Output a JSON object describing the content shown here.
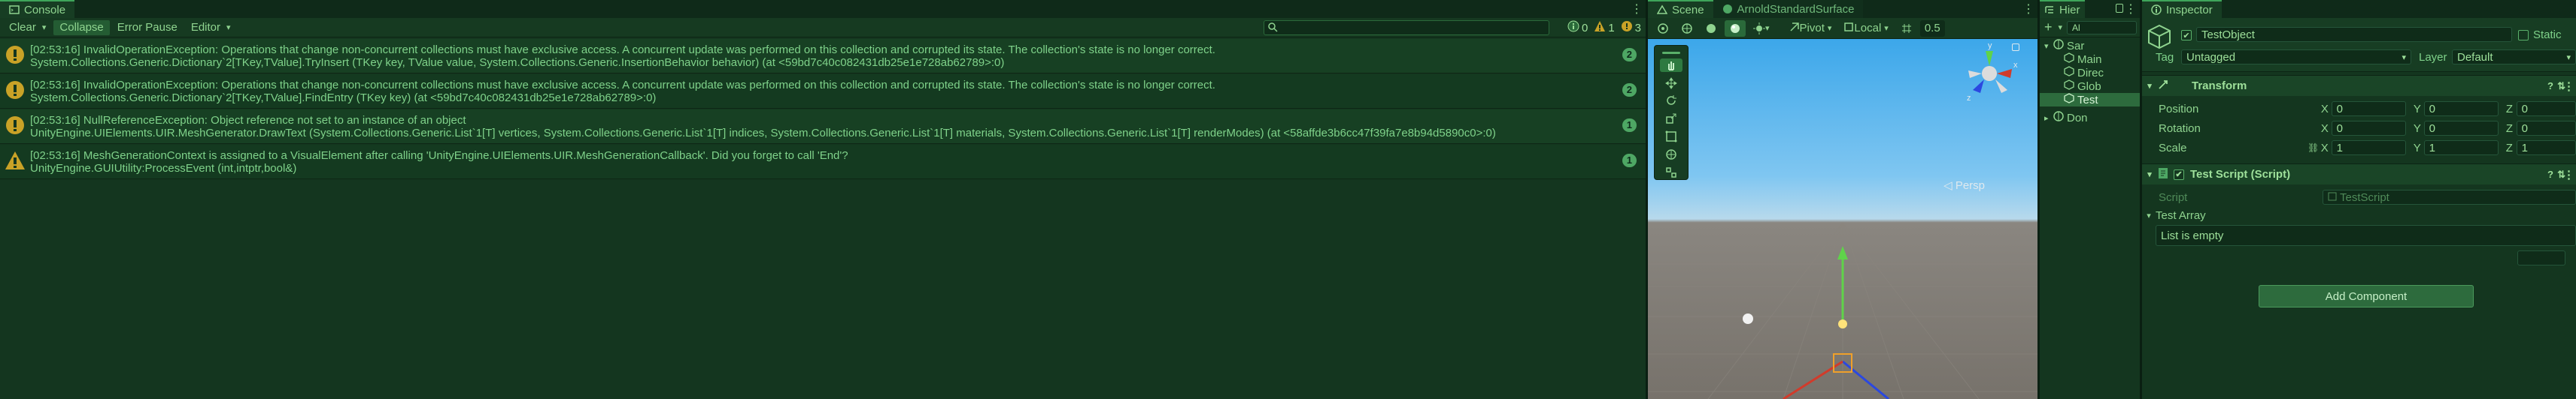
{
  "console": {
    "tab_label": "Console",
    "toolbar": {
      "clear": "Clear",
      "collapse": "Collapse",
      "error_pause": "Error Pause",
      "editor": "Editor"
    },
    "counts": {
      "log": "0",
      "warning": "1",
      "error": "3"
    },
    "logs": [
      {
        "type": "warning",
        "line1": "[02:53:16] InvalidOperationException: Operations that change non-concurrent collections must have exclusive access. A concurrent update was performed on this collection and corrupted its state. The collection's state is no longer correct.",
        "line2": "System.Collections.Generic.Dictionary`2[TKey,TValue].TryInsert (TKey key, TValue value, System.Collections.Generic.InsertionBehavior behavior) (at <59bd7c40c082431db25e1e728ab62789>:0)",
        "count": "2"
      },
      {
        "type": "warning",
        "line1": "[02:53:16] InvalidOperationException: Operations that change non-concurrent collections must have exclusive access. A concurrent update was performed on this collection and corrupted its state. The collection's state is no longer correct.",
        "line2": "System.Collections.Generic.Dictionary`2[TKey,TValue].FindEntry (TKey key) (at <59bd7c40c082431db25e1e728ab62789>:0)",
        "count": "2"
      },
      {
        "type": "warning",
        "line1": "[02:53:16] NullReferenceException: Object reference not set to an instance of an object",
        "line2": "UnityEngine.UIElements.UIR.MeshGenerator.DrawText (System.Collections.Generic.List`1[T] vertices, System.Collections.Generic.List`1[T] indices, System.Collections.Generic.List`1[T] materials, System.Collections.Generic.List`1[T] renderModes) (at <58affde3b6cc47f39fa7e8b94d5890c0>:0)",
        "count": "1"
      },
      {
        "type": "alert",
        "line1": "[02:53:16] MeshGenerationContext is assigned to a VisualElement after calling 'UnityEngine.UIElements.UIR.MeshGenerationCallback'. Did you forget to call 'End'?",
        "line2": "UnityEngine.GUIUtility:ProcessEvent (int,intptr,bool&)",
        "count": "1"
      }
    ]
  },
  "scene": {
    "tab_scene": "Scene",
    "tab_asset": "ArnoldStandardSurface",
    "pivot": "Pivot",
    "local": "Local",
    "snap": "0.5",
    "persp_label": "◁ Persp",
    "gizmo": {
      "y": "y",
      "x": "x",
      "z": "z"
    }
  },
  "hierarchy": {
    "tab_label": "Hier",
    "search_hint": "Al",
    "items": [
      {
        "label": "Sar",
        "depth": 0,
        "selected": false
      },
      {
        "label": "Main",
        "depth": 1,
        "selected": false
      },
      {
        "label": "Direc",
        "depth": 1,
        "selected": false
      },
      {
        "label": "Glob",
        "depth": 1,
        "selected": false
      },
      {
        "label": "Test",
        "depth": 1,
        "selected": true
      },
      {
        "label": "Don",
        "depth": 0,
        "selected": false
      }
    ]
  },
  "inspector": {
    "tab_label": "Inspector",
    "object_name": "TestObject",
    "static_label": "Static",
    "tag_label": "Tag",
    "tag_value": "Untagged",
    "layer_label": "Layer",
    "layer_value": "Default",
    "transform": {
      "title": "Transform",
      "position_label": "Position",
      "position": {
        "x": "0",
        "y": "0",
        "z": "0"
      },
      "rotation_label": "Rotation",
      "rotation": {
        "x": "0",
        "y": "0",
        "z": "0"
      },
      "scale_label": "Scale",
      "scale": {
        "x": "1",
        "y": "1",
        "z": "1"
      }
    },
    "script": {
      "title": "Test Script (Script)",
      "script_label": "Script",
      "script_value": "TestScript",
      "array_label": "Test Array",
      "empty_text": "List is empty"
    },
    "add_component": "Add Component"
  },
  "colors": {
    "accent": "#3ea55a",
    "background": "#14361f",
    "warning": "#c9a227",
    "sky": "#7fc6f1",
    "ground": "#807b74"
  }
}
